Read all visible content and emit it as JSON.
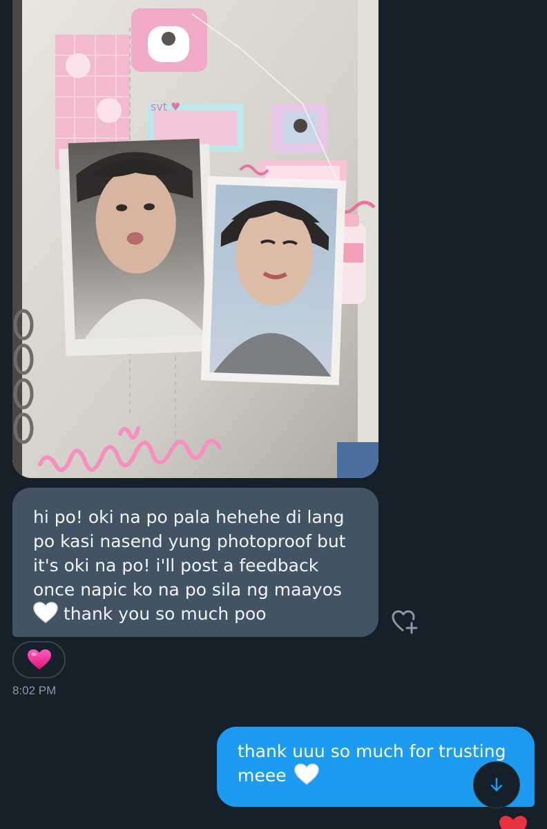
{
  "conversation": {
    "photo": {
      "icon": "photo-attachment",
      "scribble_color": "#f58fc0"
    },
    "received_message": {
      "lines": [
        "hi po! oki na po pala hehehe di lang",
        "po kasi nasend yung photoproof but",
        "it's oki na po! i'll post a feedback",
        "once napic ko na po sila ng maayos"
      ],
      "last_line_emoji": "white-heart",
      "last_line_text": "thank you so much poo",
      "reaction": "pink-heart",
      "add_reaction_icon": "heart-plus-icon",
      "timestamp": "8:02 PM"
    },
    "sent_message": {
      "line1": "thank uuu so much for trusting",
      "line2_text": "meee",
      "line2_emoji": "white-heart"
    },
    "scroll_down_icon": "arrow-down-icon",
    "colors": {
      "background": "#15202b",
      "received_bubble": "#425364",
      "sent_bubble": "#1d9bf0",
      "timestamp": "#8b98a5",
      "accent_pink": "#f5319d"
    }
  }
}
